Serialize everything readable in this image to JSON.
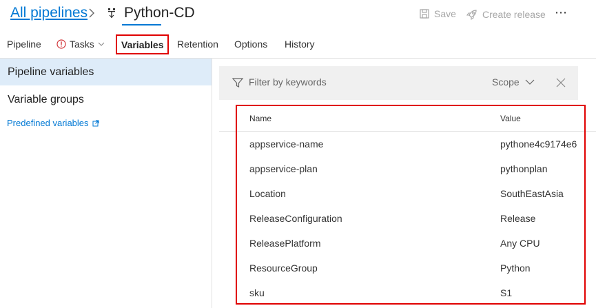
{
  "header": {
    "breadcrumb_link": "All pipelines",
    "pipeline_title": "Python-CD",
    "save_label": "Save",
    "create_release_label": "Create release",
    "more_label": "⋯"
  },
  "tabs": {
    "pipeline": "Pipeline",
    "tasks": "Tasks",
    "variables": "Variables",
    "retention": "Retention",
    "options": "Options",
    "history": "History"
  },
  "sidebar": {
    "selected": "Pipeline variables",
    "variable_groups": "Variable groups",
    "predefined": "Predefined variables"
  },
  "filter": {
    "placeholder": "Filter by keywords",
    "scope_label": "Scope"
  },
  "grid": {
    "col_name": "Name",
    "col_value": "Value",
    "rows": [
      {
        "name": "appservice-name",
        "value": "pythone4c9174e6"
      },
      {
        "name": "appservice-plan",
        "value": "pythonplan"
      },
      {
        "name": "Location",
        "value": "SouthEastAsia"
      },
      {
        "name": "ReleaseConfiguration",
        "value": "Release"
      },
      {
        "name": "ReleasePlatform",
        "value": "Any CPU"
      },
      {
        "name": "ResourceGroup",
        "value": "Python"
      },
      {
        "name": "sku",
        "value": "S1"
      }
    ]
  },
  "colors": {
    "accent": "#0078d4",
    "highlight_box": "#e00000",
    "selected_bg": "#deecf9",
    "warning": "#d13438"
  }
}
